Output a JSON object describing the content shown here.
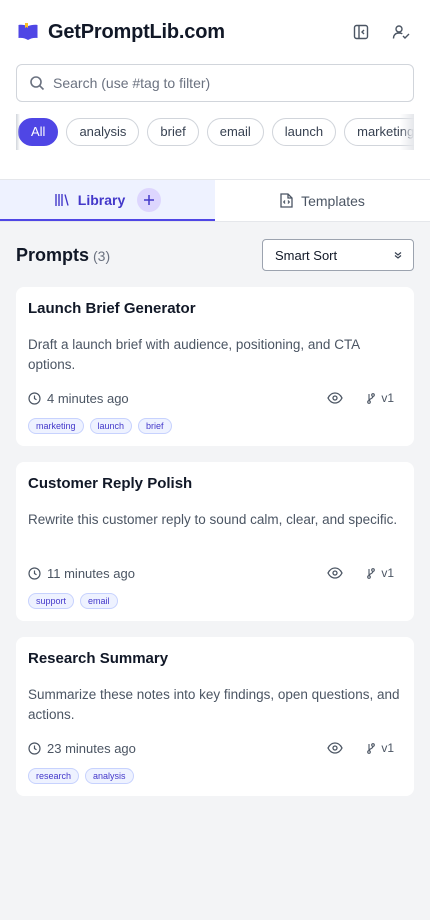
{
  "app": {
    "title": "GetPromptLib.com"
  },
  "search": {
    "placeholder": "Search (use #tag to filter)"
  },
  "filter_tags": [
    "All",
    "analysis",
    "brief",
    "email",
    "launch",
    "marketing"
  ],
  "tabs": [
    {
      "label": "Library",
      "active": true
    },
    {
      "label": "Templates",
      "active": false
    }
  ],
  "prompts": {
    "title": "Prompts",
    "count": "(3)",
    "sort_value": "Smart Sort"
  },
  "cards": [
    {
      "title": "Launch Brief Generator",
      "description": "Draft a launch brief with audience, positioning, and CTA options.",
      "time": "4 minutes ago",
      "version": "v1",
      "tags": [
        "marketing",
        "launch",
        "brief"
      ]
    },
    {
      "title": "Customer Reply Polish",
      "description": "Rewrite this customer reply to sound calm, clear, and specific.",
      "time": "11 minutes ago",
      "version": "v1",
      "tags": [
        "support",
        "email"
      ]
    },
    {
      "title": "Research Summary",
      "description": "Summarize these notes into key findings, open questions, and actions.",
      "time": "23 minutes ago",
      "version": "v1",
      "tags": [
        "research",
        "analysis"
      ]
    }
  ],
  "icons": {
    "logo": "book-open-icon",
    "sidebar": "sidebar-toggle-icon",
    "user": "user-check-icon",
    "search": "search-icon",
    "library": "library-icon",
    "templates": "file-code-icon",
    "add": "plus-icon",
    "sort": "chevrons-up-down-icon",
    "clock": "clock-icon",
    "eye": "eye-icon",
    "branch": "git-branch-icon"
  },
  "colors": {
    "accent": "#4f46e5",
    "accent_light": "#eef2ff",
    "background": "#f3f4f6"
  }
}
